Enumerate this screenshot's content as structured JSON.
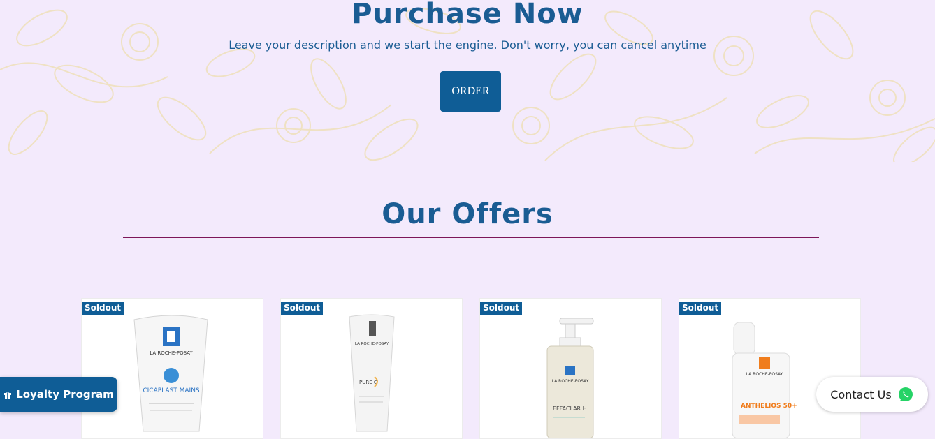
{
  "hero": {
    "title": "Purchase Now",
    "subtitle": "Leave your description and we start the engine. Don't worry, you can cancel anytime",
    "order_label": "ORDER"
  },
  "offers": {
    "title": "Our Offers",
    "products": [
      {
        "badge": "Soldout",
        "brand": "LA ROCHE-POSAY",
        "name": "CICAPLAST MAINS"
      },
      {
        "badge": "Soldout",
        "brand": "LA ROCHE-POSAY",
        "name": "PURE C"
      },
      {
        "badge": "Soldout",
        "brand": "LA ROCHE-POSAY",
        "name": "EFFACLAR H"
      },
      {
        "badge": "Soldout",
        "brand": "LA ROCHE-POSAY",
        "name": "ANTHELIOS 50+"
      }
    ]
  },
  "floating": {
    "loyalty_label": "Loyalty Program",
    "contact_label": "Contact Us",
    "loyalty_icon": "gift-icon",
    "contact_icon": "whatsapp-icon"
  },
  "colors": {
    "primary": "#0f5d96",
    "heading": "#1a5c93",
    "background": "#f3eafc",
    "floral": "#f1e6c6",
    "rule": "#7d1659",
    "whatsapp": "#25d366"
  }
}
